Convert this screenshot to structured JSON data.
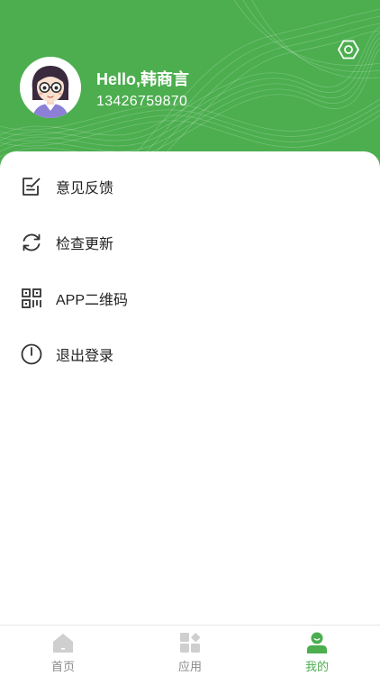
{
  "profile": {
    "greeting": "Hello,韩商言",
    "phone": "13426759870"
  },
  "menu": {
    "items": [
      {
        "label": "意见反馈",
        "icon": "feedback-icon"
      },
      {
        "label": "检查更新",
        "icon": "refresh-icon"
      },
      {
        "label": "APP二维码",
        "icon": "qrcode-icon"
      },
      {
        "label": "退出登录",
        "icon": "power-icon"
      }
    ]
  },
  "tabbar": {
    "tabs": [
      {
        "label": "首页",
        "icon": "home-icon",
        "active": false
      },
      {
        "label": "应用",
        "icon": "apps-icon",
        "active": false
      },
      {
        "label": "我的",
        "icon": "user-icon",
        "active": true
      }
    ]
  },
  "colors": {
    "brand": "#4cae4f",
    "tab_inactive": "#8a8a8a",
    "icon_inactive": "#cfcfcf"
  }
}
